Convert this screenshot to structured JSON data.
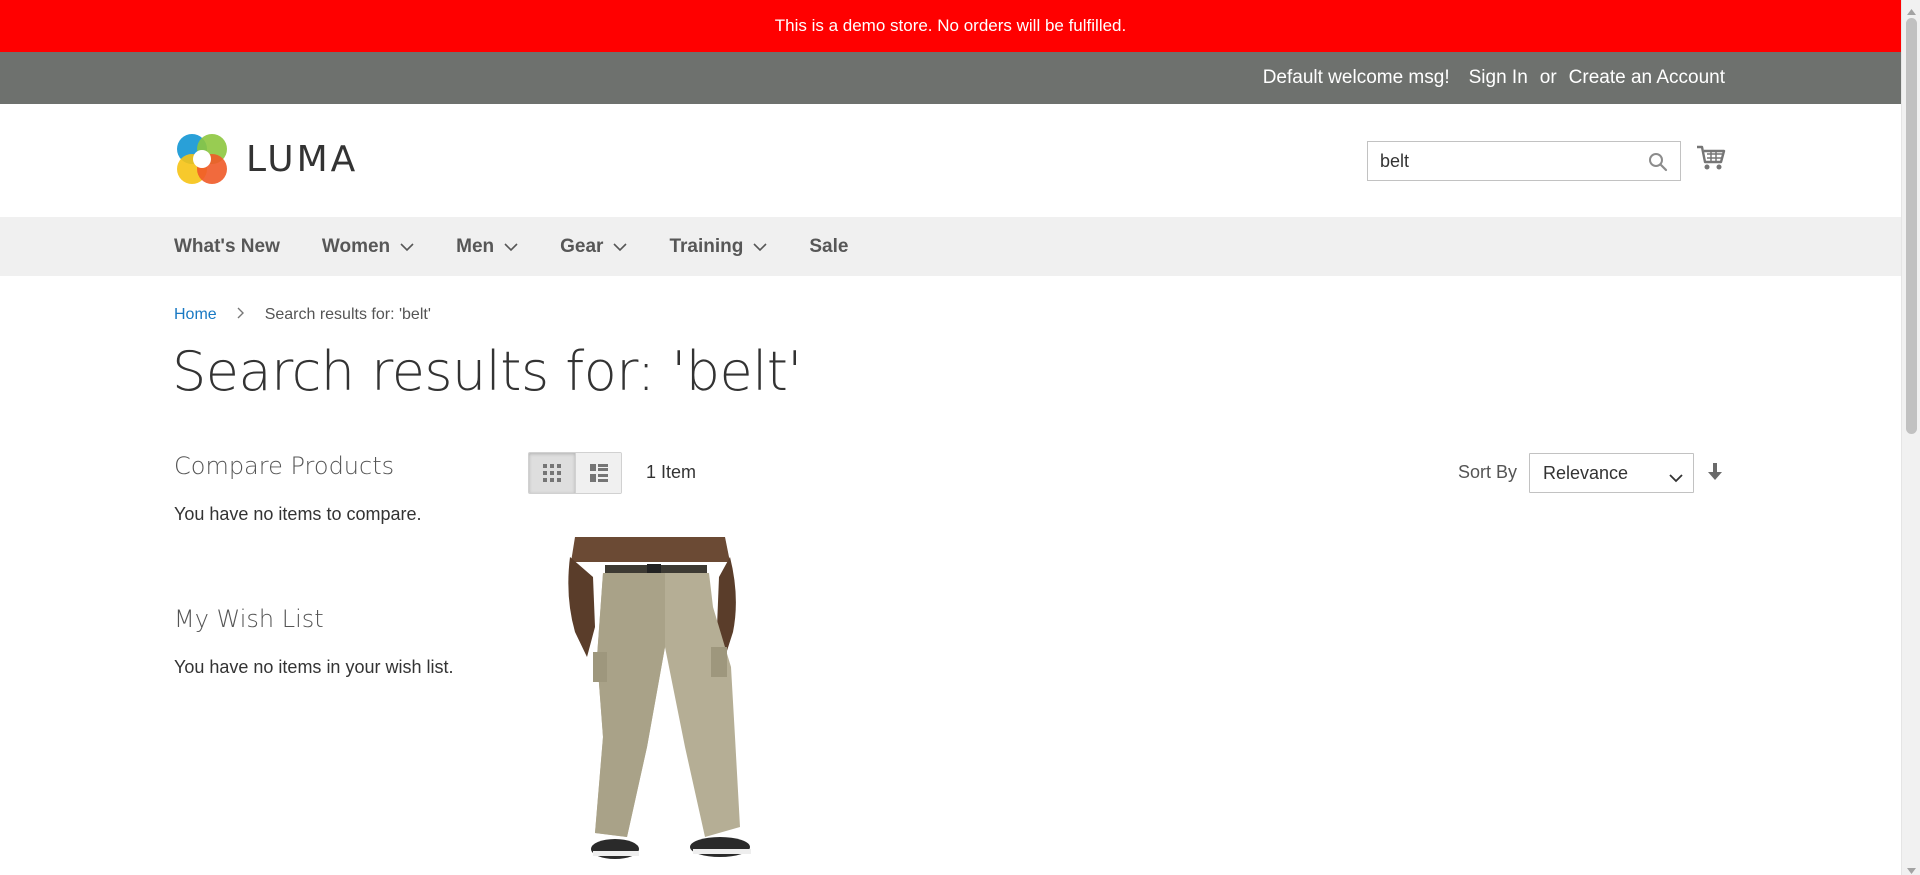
{
  "demo_notice": "This is a demo store. No orders will be fulfilled.",
  "panel": {
    "welcome": "Default welcome msg!",
    "sign_in": "Sign In",
    "or": "or",
    "create_account": "Create an Account"
  },
  "header": {
    "logo_text": "LUMA",
    "search_value": "belt",
    "search_icon": "search-icon",
    "cart_icon": "cart-icon"
  },
  "nav": {
    "items": [
      {
        "label": "What's New",
        "has_dropdown": false
      },
      {
        "label": "Women",
        "has_dropdown": true
      },
      {
        "label": "Men",
        "has_dropdown": true
      },
      {
        "label": "Gear",
        "has_dropdown": true
      },
      {
        "label": "Training",
        "has_dropdown": true
      },
      {
        "label": "Sale",
        "has_dropdown": false
      }
    ]
  },
  "breadcrumb": {
    "home": "Home",
    "current": "Search results for: 'belt'"
  },
  "page_title": "Search results for: 'belt'",
  "sidebar": {
    "compare_title": "Compare Products",
    "compare_text": "You have no items to compare.",
    "wishlist_title": "My Wish List",
    "wishlist_text": "You have no items in your wish list."
  },
  "toolbar": {
    "amount": "1 Item",
    "sort_label": "Sort By",
    "sort_value": "Relevance",
    "view_modes": [
      "grid",
      "list"
    ],
    "active_mode": "grid"
  },
  "colors": {
    "demo_bar": "#ff0000",
    "panel_bar": "#6e716e",
    "nav_bg": "#f0f0f0",
    "link": "#1979c3"
  }
}
